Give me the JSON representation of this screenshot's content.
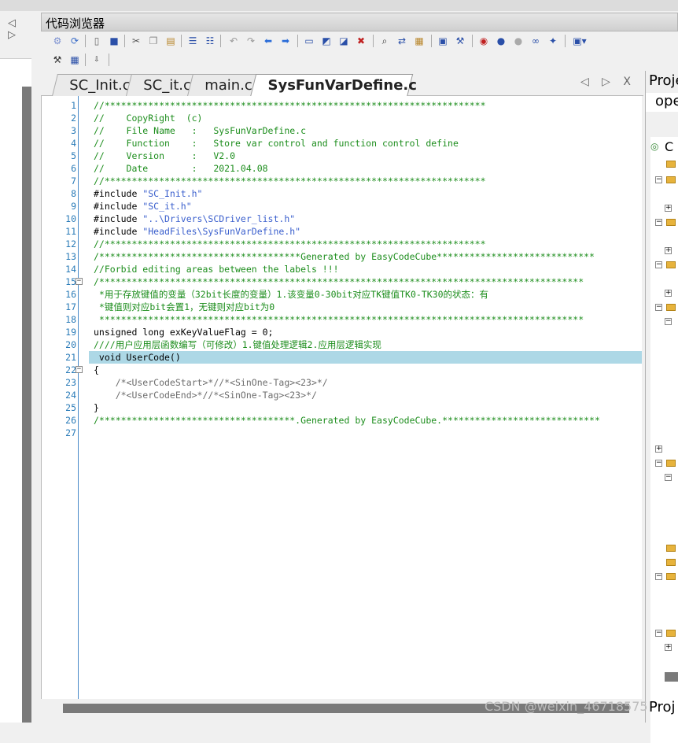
{
  "window": {
    "title": "代码浏览器"
  },
  "left_nav": "◁ ▷",
  "tabs": [
    {
      "label": "SC_Init.c",
      "active": false
    },
    {
      "label": "SC_it.c",
      "active": false
    },
    {
      "label": "main.c",
      "active": false
    },
    {
      "label": "SysFunVarDefine.c",
      "active": true
    }
  ],
  "tab_nav": "◁ ▷ X",
  "code_lines": [
    {
      "n": "1",
      "fold": "",
      "text": "//**********************************************************************",
      "cls": "c-com"
    },
    {
      "n": "2",
      "fold": "",
      "text": "//    CopyRight  (c)",
      "cls": "c-com"
    },
    {
      "n": "3",
      "fold": "",
      "text": "//    File Name   :   SysFunVarDefine.c",
      "cls": "c-com"
    },
    {
      "n": "4",
      "fold": "",
      "text": "//    Function    :   Store var control and function control define",
      "cls": "c-com"
    },
    {
      "n": "5",
      "fold": "",
      "text": "//    Version     :   V2.0",
      "cls": "c-com"
    },
    {
      "n": "6",
      "fold": "",
      "text": "//    Date        :   2021.04.08",
      "cls": "c-com"
    },
    {
      "n": "7",
      "fold": "",
      "text": "//**********************************************************************",
      "cls": "c-com"
    },
    {
      "n": "8",
      "fold": "",
      "pre": "#include ",
      "text": "\"SC_Init.h\"",
      "cls": "c-str"
    },
    {
      "n": "9",
      "fold": "",
      "pre": "#include ",
      "text": "\"SC_it.h\"",
      "cls": "c-str"
    },
    {
      "n": "10",
      "fold": "",
      "pre": "#include ",
      "text": "\"..\\Drivers\\SCDriver_list.h\"",
      "cls": "c-str"
    },
    {
      "n": "11",
      "fold": "",
      "pre": "#include ",
      "text": "\"HeadFiles\\SysFunVarDefine.h\"",
      "cls": "c-str"
    },
    {
      "n": "12",
      "fold": "",
      "text": "//**********************************************************************",
      "cls": "c-com"
    },
    {
      "n": "13",
      "fold": "",
      "text": "/*************************************Generated by EasyCodeCube*****************************",
      "cls": "c-com"
    },
    {
      "n": "14",
      "fold": "",
      "text": "//Forbid editing areas between the labels !!!",
      "cls": "c-com"
    },
    {
      "n": "15",
      "fold": "−",
      "text": "/*****************************************************************************************",
      "cls": "c-com"
    },
    {
      "n": "16",
      "fold": "",
      "text": " *用于存放键值的变量（32bit长度的变量）1.该变量0-30bit对应TK键值TK0-TK30的状态：有",
      "cls": "c-com"
    },
    {
      "n": "17",
      "fold": "",
      "text": " *键值则对应bit会置1，无键则对应bit为0",
      "cls": "c-com"
    },
    {
      "n": "18",
      "fold": "",
      "text": " *****************************************************************************************",
      "cls": "c-com"
    },
    {
      "n": "19",
      "fold": "",
      "text": "unsigned long exKeyValueFlag = 0;",
      "cls": "c-kw"
    },
    {
      "n": "20",
      "fold": "",
      "text": "////用户应用层函数编写（可修改）1.键值处理逻辑2.应用层逻辑实现",
      "cls": "c-com"
    },
    {
      "n": "21",
      "fold": "",
      "text": " void UserCode()",
      "cls": "c-kw",
      "highlight": true
    },
    {
      "n": "22",
      "fold": "−",
      "text": "{",
      "cls": ""
    },
    {
      "n": "23",
      "fold": "",
      "text": "    /*<UserCodeStart>*//*<SinOne-Tag><23>*/",
      "cls": "c-tag"
    },
    {
      "n": "24",
      "fold": "",
      "text": "    /*<UserCodeEnd>*//*<SinOne-Tag><23>*/",
      "cls": "c-tag"
    },
    {
      "n": "25",
      "fold": "",
      "text": "}",
      "cls": ""
    },
    {
      "n": "26",
      "fold": "",
      "text": "/************************************.Generated by EasyCodeCube.*****************************",
      "cls": "c-com"
    },
    {
      "n": "27",
      "fold": "",
      "text": "",
      "cls": ""
    }
  ],
  "right_panel": {
    "title": "Proje",
    "subtitle": "ope",
    "root": "C",
    "bottom": "Proj"
  },
  "watermark": "CSDN @weixin_46718575"
}
